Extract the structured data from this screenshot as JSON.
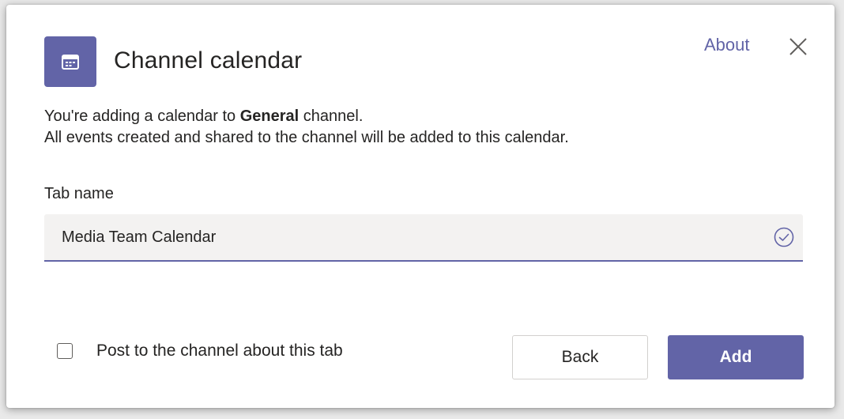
{
  "dialog": {
    "title": "Channel calendar",
    "about_label": "About",
    "description": {
      "line1_prefix": "You're adding a calendar to ",
      "channel_name": "General",
      "line1_suffix": " channel.",
      "line2": "All events created and shared to the channel will be added to this calendar."
    },
    "tab_name": {
      "label": "Tab name",
      "value": "Media Team Calendar"
    },
    "post_checkbox": {
      "label": "Post to the channel about this tab",
      "checked": false
    },
    "buttons": {
      "back_label": "Back",
      "add_label": "Add"
    }
  },
  "colors": {
    "accent": "#6264a7",
    "text": "#252423",
    "input_bg": "#f3f2f1"
  },
  "icons": {
    "app": "calendar-icon",
    "close": "close-icon",
    "valid": "check-circle-icon"
  }
}
